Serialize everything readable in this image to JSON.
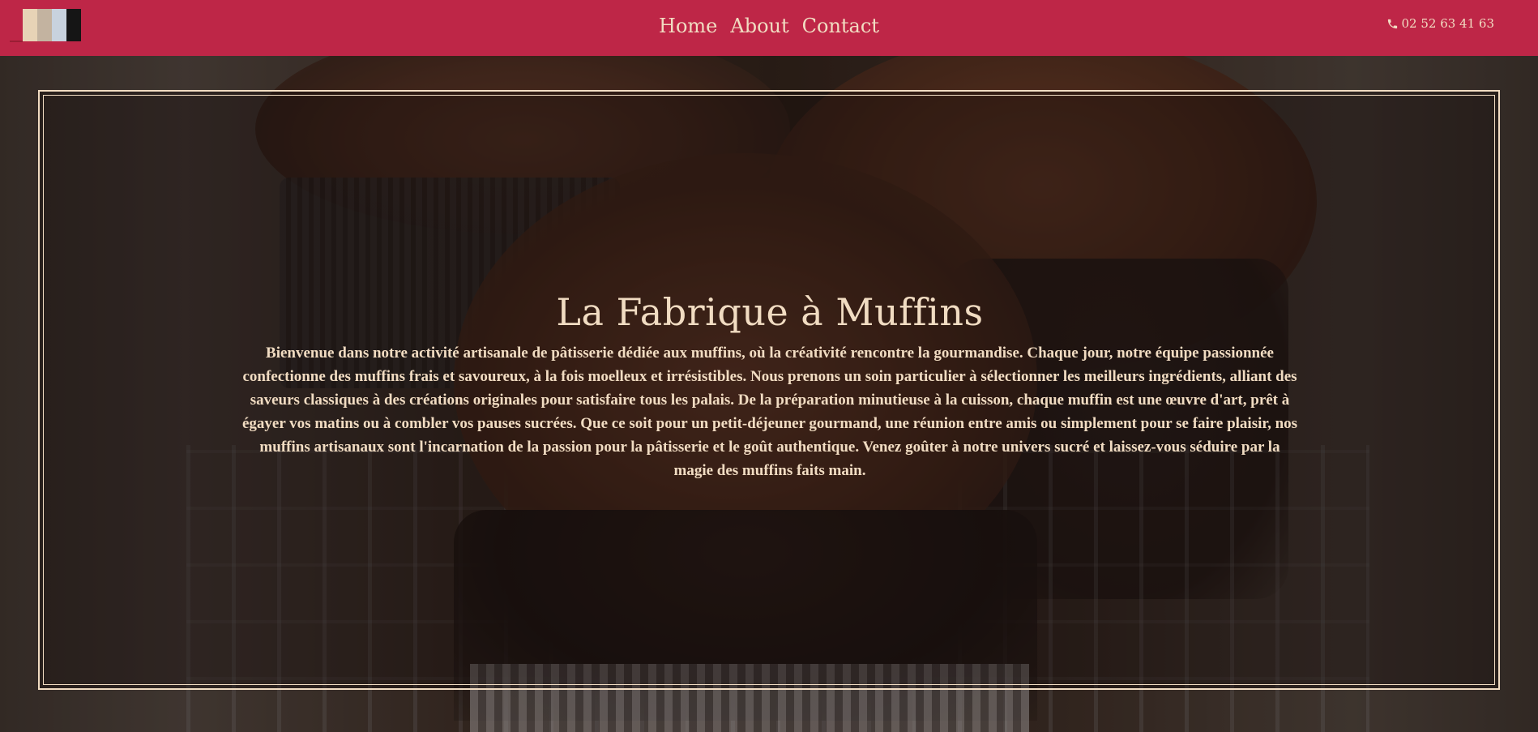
{
  "brand": {
    "logo_colors": [
      "#e7d3b6",
      "#c3b3a0",
      "#c8d2de",
      "#151515"
    ]
  },
  "nav": {
    "items": [
      {
        "label": "Home"
      },
      {
        "label": "About"
      },
      {
        "label": "Contact"
      }
    ],
    "phone": "02 52 63 41 63",
    "phone_icon": "phone-icon"
  },
  "hero": {
    "title": "La Fabrique à Muffins",
    "text": "Bienvenue dans notre activité artisanale de pâtisserie dédiée aux muffins, où la créativité rencontre la gourmandise. Chaque jour, notre équipe passionnée confectionne des muffins frais et savoureux, à la fois moelleux et irrésistibles. Nous prenons un soin particulier à sélectionner les meilleurs ingrédients, alliant des saveurs classiques à des créations originales pour satisfaire tous les palais. De la préparation minutieuse à la cuisson, chaque muffin est une œuvre d'art, prêt à égayer vos matins ou à combler vos pauses sucrées. Que ce soit pour un petit-déjeuner gourmand, une réunion entre amis ou simplement pour se faire plaisir, nos muffins artisanaux sont l'incarnation de la passion pour la pâtisserie et le goût authentique. Venez goûter à notre univers sucré et laissez-vous séduire par la magie des muffins faits main."
  },
  "colors": {
    "navbar_bg": "#be2647",
    "accent_text": "#f1dcc2"
  }
}
